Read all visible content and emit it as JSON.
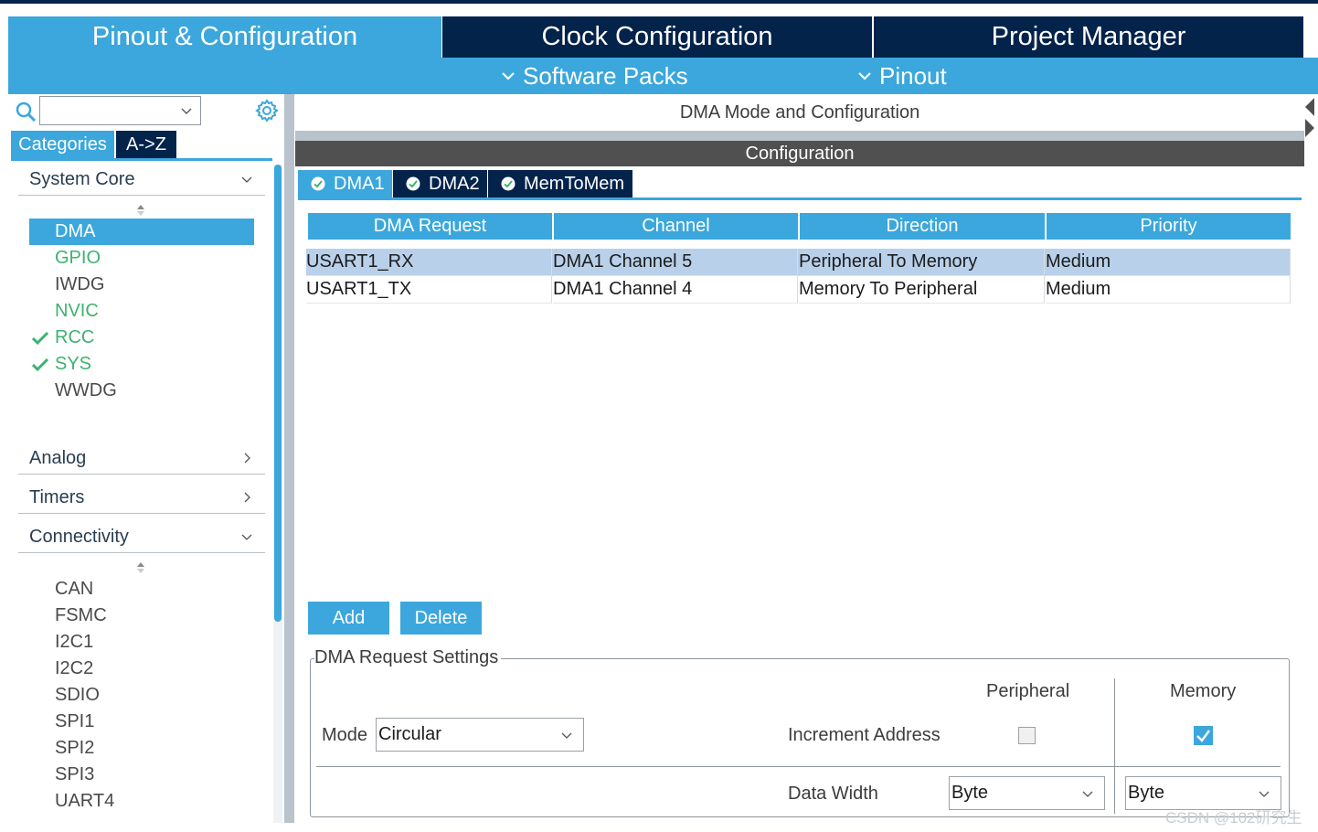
{
  "app": {
    "main_tabs": [
      {
        "label": "Pinout & Configuration"
      },
      {
        "label": "Clock Configuration"
      },
      {
        "label": "Project Manager"
      }
    ],
    "subnav": [
      {
        "label": "Software Packs"
      },
      {
        "label": "Pinout"
      }
    ]
  },
  "sidebar": {
    "search_value": "",
    "tabs": [
      {
        "label": "Categories"
      },
      {
        "label": "A->Z"
      }
    ],
    "categories": [
      {
        "label": "System Core",
        "expanded": true
      },
      {
        "label": "Analog",
        "expanded": false
      },
      {
        "label": "Timers",
        "expanded": false
      },
      {
        "label": "Connectivity",
        "expanded": true
      }
    ],
    "system_core_items": [
      {
        "label": "DMA",
        "state": "selected"
      },
      {
        "label": "GPIO",
        "state": "green"
      },
      {
        "label": "IWDG",
        "state": "normal"
      },
      {
        "label": "NVIC",
        "state": "green"
      },
      {
        "label": "RCC",
        "state": "checked"
      },
      {
        "label": "SYS",
        "state": "checked"
      },
      {
        "label": "WWDG",
        "state": "normal"
      }
    ],
    "connectivity_items": [
      {
        "label": "CAN"
      },
      {
        "label": "FSMC"
      },
      {
        "label": "I2C1"
      },
      {
        "label": "I2C2"
      },
      {
        "label": "SDIO"
      },
      {
        "label": "SPI1"
      },
      {
        "label": "SPI2"
      },
      {
        "label": "SPI3"
      },
      {
        "label": "UART4"
      }
    ]
  },
  "main": {
    "mode_title": "DMA Mode and Configuration",
    "config_title": "Configuration",
    "dma_tabs": [
      {
        "label": "DMA1"
      },
      {
        "label": "DMA2"
      },
      {
        "label": "MemToMem"
      }
    ],
    "table": {
      "headers": [
        "DMA Request",
        "Channel",
        "Direction",
        "Priority"
      ],
      "rows": [
        [
          "USART1_RX",
          "DMA1 Channel 5",
          "Peripheral To Memory",
          "Medium"
        ],
        [
          "USART1_TX",
          "DMA1 Channel 4",
          "Memory To Peripheral",
          "Medium"
        ]
      ]
    },
    "buttons": {
      "add": "Add",
      "delete": "Delete"
    },
    "settings": {
      "legend": "DMA Request Settings",
      "mode_label": "Mode",
      "mode_value": "Circular",
      "col_peripheral": "Peripheral",
      "col_memory": "Memory",
      "increment_label": "Increment Address",
      "peripheral_increment": false,
      "memory_increment": true,
      "data_width_label": "Data Width",
      "peripheral_width": "Byte",
      "memory_width": "Byte"
    }
  },
  "watermark": "CSDN @102研究生",
  "colors": {
    "accent": "#3ba7dc",
    "dark_navy": "#03234b",
    "selection": "#b9d0ea",
    "green": "#3cb371"
  }
}
